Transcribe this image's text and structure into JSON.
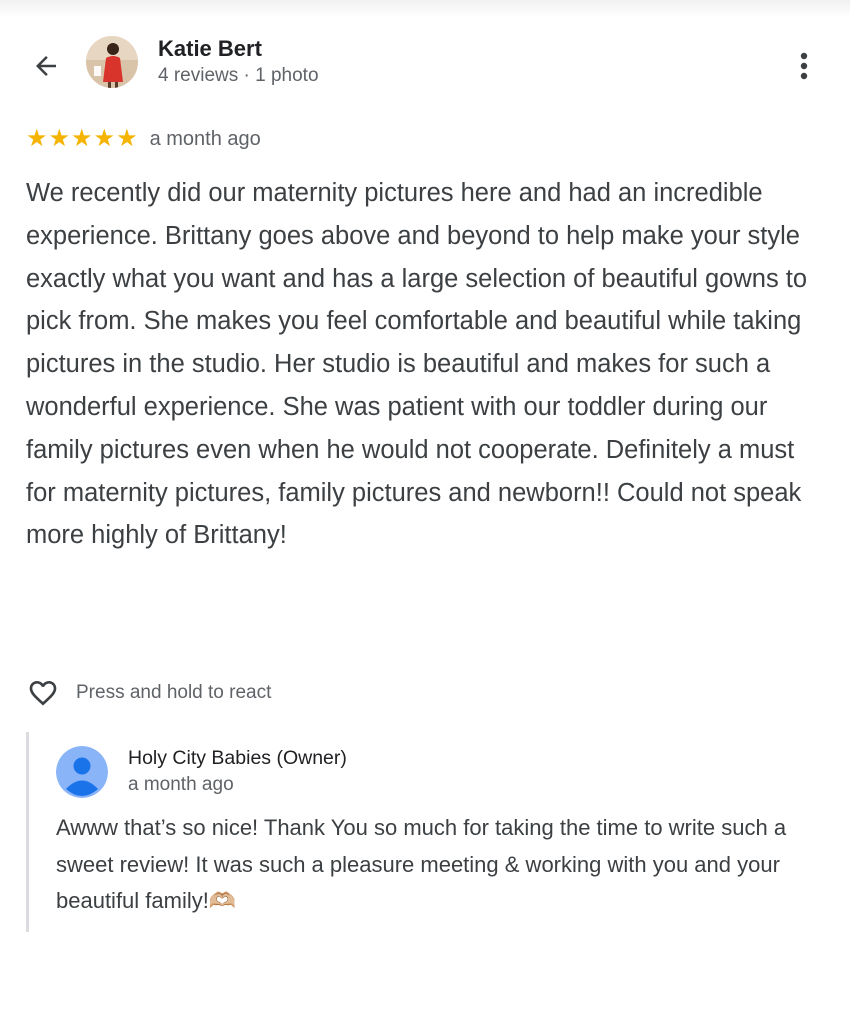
{
  "reviewer": {
    "name": "Katie Bert",
    "meta": "4 reviews · 1 photo"
  },
  "review": {
    "rating": 5,
    "rating_max": 5,
    "time": "a month ago",
    "text": "We recently did our maternity pictures here and had an incredible experience. Brittany goes above and beyond to help make your style exactly what you want and has a large selection of beautiful gowns to pick from. She makes you feel comfortable and beautiful while taking pictures in the studio. Her studio is beautiful and makes for such a wonderful experience. She was patient with our toddler during our family pictures even when he would not cooperate. Definitely a must for maternity pictures, family pictures and newborn!! Could not speak more highly of Brittany!"
  },
  "react": {
    "label": "Press and hold to react"
  },
  "owner_response": {
    "name": "Holy City Babies (Owner)",
    "time": "a month ago",
    "text": "Awww that’s so nice! Thank You so much for taking the time to write such a sweet review! It was such a pleasure meeting & working with you and your beautiful family!🫶🏼"
  },
  "icons": {
    "back": "arrow-back-icon",
    "more": "more-vert-icon",
    "star": "star-icon",
    "heart": "heart-outline-icon",
    "owner_avatar": "default-person-icon"
  },
  "colors": {
    "star": "#f4b400",
    "primary_text": "#202124",
    "body_text": "#3c4043",
    "secondary_text": "#5f6368",
    "divider": "#dadce0",
    "owner_avatar_bg": "#8ab4f8",
    "owner_avatar_fg": "#1a73e8"
  }
}
